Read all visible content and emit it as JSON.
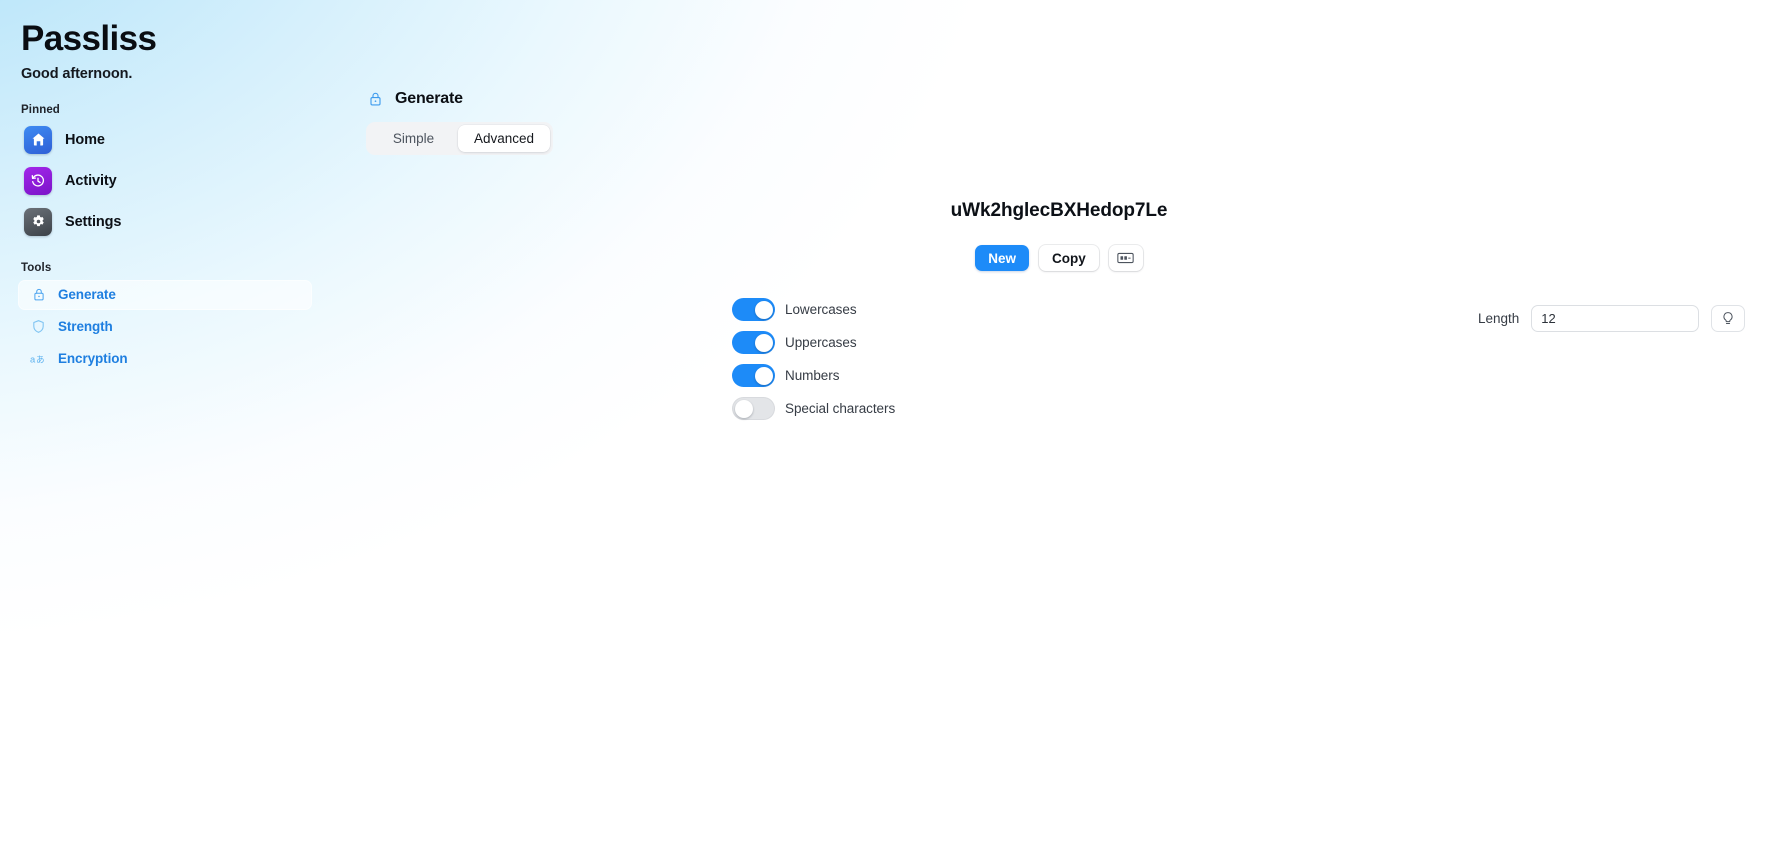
{
  "app": {
    "title": "Passliss",
    "greeting": "Good afternoon."
  },
  "sidebar": {
    "pinned_label": "Pinned",
    "tools_label": "Tools",
    "pinned": [
      {
        "label": "Home",
        "icon": "home-icon",
        "color": "#2b6fe3"
      },
      {
        "label": "Activity",
        "icon": "clock-history-icon",
        "color": "#9b1fe0"
      },
      {
        "label": "Settings",
        "icon": "gear-icon",
        "color": "#4a5058"
      }
    ],
    "tools": [
      {
        "label": "Generate",
        "icon": "lock-icon",
        "active": true
      },
      {
        "label": "Strength",
        "icon": "shield-icon",
        "active": false
      },
      {
        "label": "Encryption",
        "icon": "translate-icon",
        "active": false
      }
    ]
  },
  "main": {
    "page_title": "Generate",
    "page_icon": "lock-icon",
    "tabs": [
      {
        "label": "Simple",
        "active": false
      },
      {
        "label": "Advanced",
        "active": true
      }
    ],
    "password": "uWk2hglecBXHedop7Le",
    "actions": {
      "new_label": "New",
      "copy_label": "Copy",
      "extra_icon": "password-card-icon"
    },
    "options": [
      {
        "label": "Lowercases",
        "on": true
      },
      {
        "label": "Uppercases",
        "on": true
      },
      {
        "label": "Numbers",
        "on": true
      },
      {
        "label": "Special characters",
        "on": false
      }
    ],
    "length": {
      "label": "Length",
      "value": "12",
      "placeholder": "12",
      "hint_icon": "lightbulb-icon"
    }
  },
  "colors": {
    "accent": "#1d8bf8",
    "tool_link": "#1f7fe0",
    "background_top_left": "#a9dff8",
    "background_bottom_right": "#ffffff"
  }
}
